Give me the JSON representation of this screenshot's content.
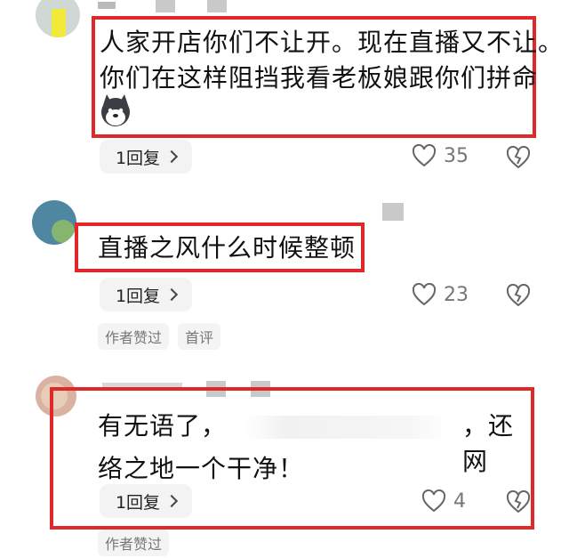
{
  "comments": [
    {
      "text_line1": "人家开店你们不让开。现在直播又不让。",
      "text_line2": "你们在这样阻挡我看老板娘跟你们拼命",
      "reply_label": "1回复",
      "like_count": "35"
    },
    {
      "text_line1": "直播之风什么时候整顿",
      "reply_label": "1回复",
      "like_count": "23",
      "tags": [
        "作者赞过",
        "首评"
      ]
    },
    {
      "text_line1_a": "有无语了，",
      "text_line1_b": "，还网",
      "text_line2": "络之地一个干净！",
      "reply_label": "1回复",
      "like_count": "4",
      "tags": [
        "作者赞过"
      ]
    }
  ],
  "icons": [
    "heart-outline-icon",
    "broken-heart-icon",
    "chevron-right-icon",
    "husky-dog-emoji"
  ],
  "colors": {
    "highlight": "#e0272a",
    "text": "#111111",
    "muted": "#777777",
    "button_bg": "#f3f3f3"
  }
}
